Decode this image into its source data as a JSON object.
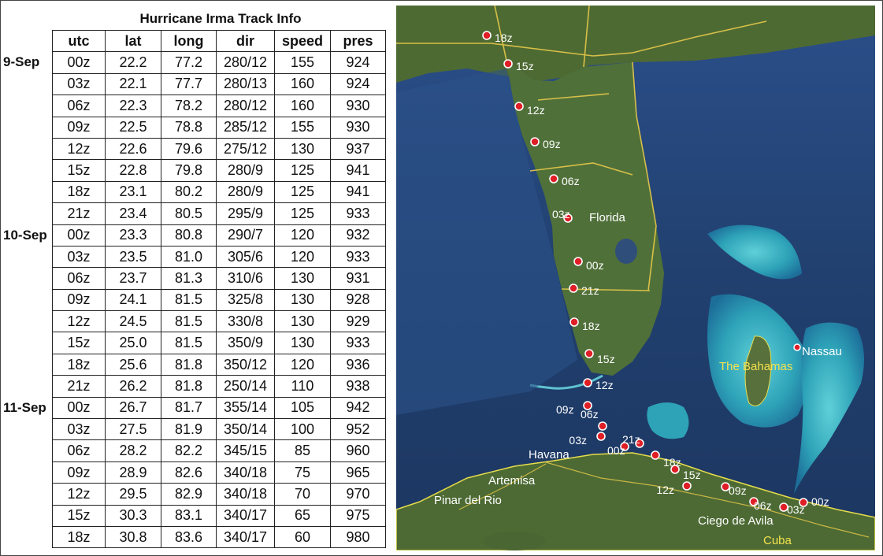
{
  "title": "Hurricane Irma Track Info",
  "columns": [
    "utc",
    "lat",
    "long",
    "dir",
    "speed",
    "pres"
  ],
  "day_labels": [
    {
      "text": "9-Sep",
      "row": 0
    },
    {
      "text": "10-Sep",
      "row": 8
    },
    {
      "text": "11-Sep",
      "row": 16
    }
  ],
  "rows": [
    [
      "00z",
      "22.2",
      "77.2",
      "280/12",
      "155",
      "924"
    ],
    [
      "03z",
      "22.1",
      "77.7",
      "280/13",
      "160",
      "924"
    ],
    [
      "06z",
      "22.3",
      "78.2",
      "280/12",
      "160",
      "930"
    ],
    [
      "09z",
      "22.5",
      "78.8",
      "285/12",
      "155",
      "930"
    ],
    [
      "12z",
      "22.6",
      "79.6",
      "275/12",
      "130",
      "937"
    ],
    [
      "15z",
      "22.8",
      "79.8",
      "280/9",
      "125",
      "941"
    ],
    [
      "18z",
      "23.1",
      "80.2",
      "280/9",
      "125",
      "941"
    ],
    [
      "21z",
      "23.4",
      "80.5",
      "295/9",
      "125",
      "933"
    ],
    [
      "00z",
      "23.3",
      "80.8",
      "290/7",
      "120",
      "932"
    ],
    [
      "03z",
      "23.5",
      "81.0",
      "305/6",
      "120",
      "933"
    ],
    [
      "06z",
      "23.7",
      "81.3",
      "310/6",
      "130",
      "931"
    ],
    [
      "09z",
      "24.1",
      "81.5",
      "325/8",
      "130",
      "928"
    ],
    [
      "12z",
      "24.5",
      "81.5",
      "330/8",
      "130",
      "929"
    ],
    [
      "15z",
      "25.0",
      "81.5",
      "350/9",
      "130",
      "933"
    ],
    [
      "18z",
      "25.6",
      "81.8",
      "350/12",
      "120",
      "936"
    ],
    [
      "21z",
      "26.2",
      "81.8",
      "250/14",
      "110",
      "938"
    ],
    [
      "00z",
      "26.7",
      "81.7",
      "355/14",
      "105",
      "942"
    ],
    [
      "03z",
      "27.5",
      "81.9",
      "350/14",
      "100",
      "952"
    ],
    [
      "06z",
      "28.2",
      "82.2",
      "345/15",
      "85",
      "960"
    ],
    [
      "09z",
      "28.9",
      "82.6",
      "340/18",
      "75",
      "965"
    ],
    [
      "12z",
      "29.5",
      "82.9",
      "340/18",
      "70",
      "970"
    ],
    [
      "15z",
      "30.3",
      "83.1",
      "340/17",
      "65",
      "975"
    ],
    [
      "18z",
      "30.8",
      "83.6",
      "340/17",
      "60",
      "980"
    ]
  ],
  "map": {
    "place_labels": {
      "florida": "Florida",
      "bahamas": "The Bahamas",
      "nassau": "Nassau",
      "havana": "Havana",
      "artemisa": "Artemisa",
      "pinar": "Pinar del Rio",
      "ciego": "Ciego de Avila",
      "cuba": "Cuba"
    },
    "track_labels": {
      "m0": "00z",
      "m1": "03z",
      "m2": "06z",
      "m3": "09z",
      "m4": "12z",
      "m5": "15z",
      "m6": "18z",
      "m7": "21z",
      "m8": "00z",
      "m9": "03z",
      "m10": "06z",
      "m11": "09z",
      "m12": "12z",
      "m13": "15z",
      "m14": "18z",
      "m15": "21z",
      "m16": "00z",
      "m17": "03z",
      "m18": "06z",
      "m19": "09z",
      "m20": "12z",
      "m21": "15z",
      "m22": "18z"
    },
    "colors": {
      "marker": "#e01e26",
      "ocean": "#233f73",
      "land": "#4f6a35",
      "boundary": "#f2d64a",
      "label_yellow": "#f4e24e"
    }
  }
}
